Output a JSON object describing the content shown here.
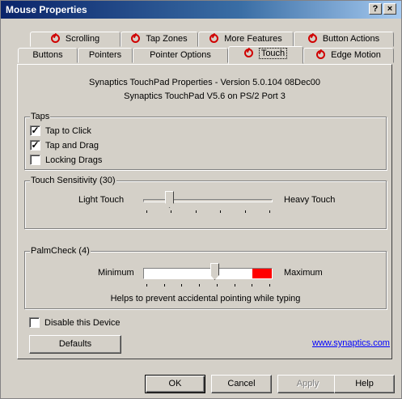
{
  "window": {
    "title": "Mouse Properties",
    "help_glyph": "?",
    "close_glyph": "×"
  },
  "tabs": {
    "row1": [
      {
        "label": "Scrolling",
        "icon": "synaptics-icon"
      },
      {
        "label": "Tap Zones",
        "icon": "synaptics-icon"
      },
      {
        "label": "More Features",
        "icon": "synaptics-icon"
      },
      {
        "label": "Button Actions",
        "icon": "synaptics-icon"
      }
    ],
    "row2": [
      {
        "label": "Buttons"
      },
      {
        "label": "Pointers"
      },
      {
        "label": "Pointer Options"
      },
      {
        "label": "Touch",
        "icon": "synaptics-icon",
        "selected": true
      },
      {
        "label": "Edge Motion",
        "icon": "synaptics-icon"
      }
    ]
  },
  "header": {
    "line1": "Synaptics TouchPad Properties - Version 5.0.104 08Dec00",
    "line2": "Synaptics TouchPad V5.6 on PS/2 Port 3"
  },
  "taps": {
    "title": "Taps",
    "options": [
      {
        "label": "Tap to Click",
        "checked": true,
        "mark": "✓"
      },
      {
        "label": "Tap and Drag",
        "checked": true,
        "mark": "✓"
      },
      {
        "label": "Locking Drags",
        "checked": false,
        "mark": ""
      }
    ]
  },
  "touch_sensitivity": {
    "title": "Touch Sensitivity (30)",
    "min_label": "Light Touch",
    "max_label": "Heavy Touch",
    "value_fraction": 0.2
  },
  "palmcheck": {
    "title": "PalmCheck (4)",
    "min_label": "Minimum",
    "max_label": "Maximum",
    "hint": "Helps to prevent accidental pointing while typing",
    "value_fraction": 0.55,
    "red_zone_start_fraction": 0.85
  },
  "disable_device": {
    "label": "Disable this Device",
    "checked": false
  },
  "defaults_button": "Defaults",
  "website_link": "www.synaptics.com",
  "dialog_buttons": {
    "ok": "OK",
    "cancel": "Cancel",
    "apply": "Apply",
    "help": "Help"
  },
  "colors": {
    "title_bar": "#0a246a",
    "palm_red": "#ff0000",
    "link": "#0000ff",
    "face": "#d4d0c8"
  }
}
